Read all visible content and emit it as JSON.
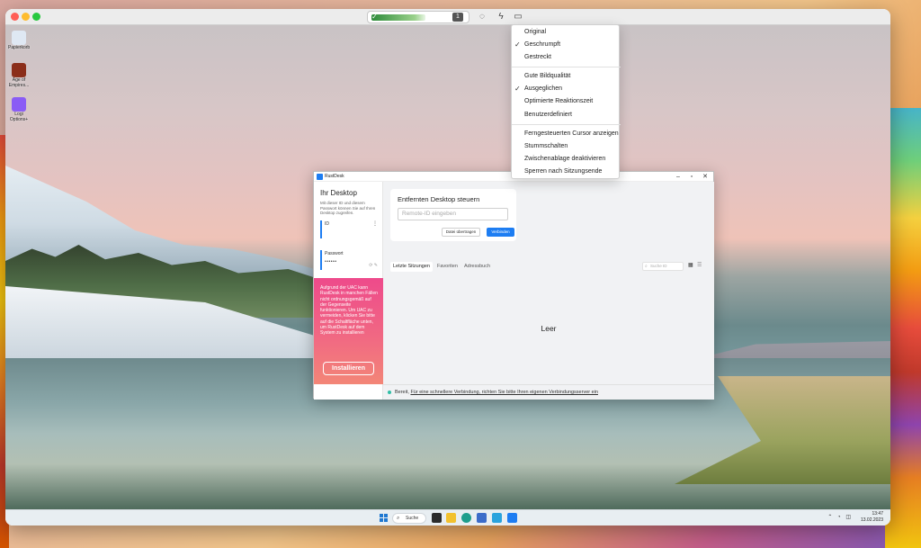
{
  "toolbar": {
    "quality_badge": "1"
  },
  "desktop_icons": [
    {
      "label": "Papierkorb",
      "color": "#3a7bd5"
    },
    {
      "label": "Age of Empires...",
      "color": "#8b2e1a"
    },
    {
      "label": "Logi Options+",
      "color": "#8a5cf5"
    }
  ],
  "rustdesk": {
    "title": "RustDesk",
    "your_desktop": "Ihr Desktop",
    "desc": "Mit dieser ID und diesem Passwort können Sie auf Ihren Desktop zugreifen.",
    "id_label": "ID",
    "password_label": "Passwort",
    "password_value": "••••••",
    "uac_text": "Aufgrund der UAC kann RustDesk in manchen Fällen nicht ordnungsgemäß auf der Gegenseite funktionieren. Um UAC zu vermeiden, klicken Sie bitte auf die Schaltfläche unten, um RustDesk auf dem System zu installieren",
    "install_button": "Installieren",
    "connect_title": "Entfernten Desktop steuern",
    "remote_id_placeholder": "Remote-ID eingeben",
    "transfer_button": "Datei übertragen",
    "connect_button": "Verbinden",
    "tabs": [
      "Letzte Sitzungen",
      "Favoriten",
      "Adressbuch"
    ],
    "search_placeholder": "Suche ID",
    "empty_label": "Leer",
    "status_ready": "Bereit,",
    "status_link": "Für eine schnellere Verbindung, richten Sie bitte Ihren eigenen Verbindungsserver ein"
  },
  "taskbar": {
    "search_label": "Suche",
    "time": "13:47",
    "date": "13.02.2023",
    "apps": [
      {
        "name": "files",
        "color": "#2b2b2b"
      },
      {
        "name": "explorer",
        "color": "#f2c12e"
      },
      {
        "name": "edge",
        "color": "#1e9e8c"
      },
      {
        "name": "store",
        "color": "#3b6cc9"
      },
      {
        "name": "telegram",
        "color": "#2aa3dd"
      },
      {
        "name": "rustdesk",
        "color": "#1d7df2"
      }
    ]
  },
  "menu": {
    "items": [
      {
        "label": "Original",
        "checked": false
      },
      {
        "label": "Geschrumpft",
        "checked": true
      },
      {
        "label": "Gestreckt",
        "checked": false
      },
      {
        "label": "Gute Bildqualität",
        "checked": false
      },
      {
        "label": "Ausgeglichen",
        "checked": true
      },
      {
        "label": "Optimierte Reaktionszeit",
        "checked": false
      },
      {
        "label": "Benutzerdefiniert",
        "checked": false
      },
      {
        "label": "Ferngesteuerten Cursor anzeigen",
        "checked": false
      },
      {
        "label": "Stummschalten",
        "checked": false
      },
      {
        "label": "Zwischenablage deaktivieren",
        "checked": false
      },
      {
        "label": "Sperren nach Sitzungsende",
        "checked": false
      }
    ]
  },
  "colors": {
    "accent": "#1d7df2",
    "uac_pink": "#ee4a8b",
    "status_green": "#32bea6"
  }
}
